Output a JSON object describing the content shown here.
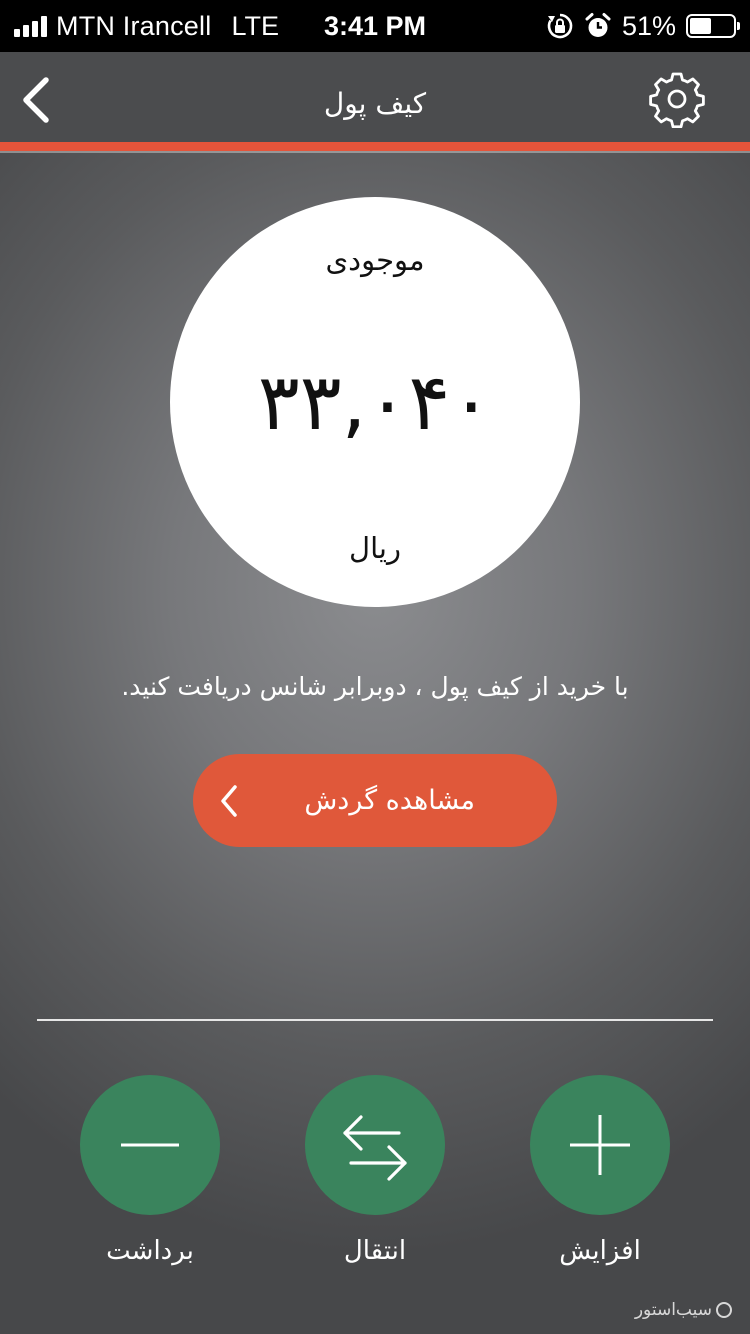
{
  "status_bar": {
    "carrier": "MTN Irancell",
    "network": "LTE",
    "time": "3:41 PM",
    "battery": "51%",
    "battery_level": 0.51
  },
  "header": {
    "title": "کیف پول",
    "back_icon": "chevron-left-icon",
    "settings_icon": "gear-icon"
  },
  "balance": {
    "label": "موجودی",
    "amount": "۳۳,۰۴۰",
    "currency": "ریال"
  },
  "promo": {
    "text": "با خرید از کیف پول ، دوبرابر شانس دریافت کنید."
  },
  "history_button": {
    "label": "مشاهده گردش"
  },
  "actions": [
    {
      "label": "برداشت",
      "icon": "minus-icon"
    },
    {
      "label": "انتقال",
      "icon": "transfer-arrows-icon"
    },
    {
      "label": "افزایش",
      "icon": "plus-icon"
    }
  ],
  "watermark": {
    "text": "سیب‌استور"
  },
  "colors": {
    "accent": "#e5543a",
    "action_green": "#3a845d",
    "nav_background": "#4b4c4e"
  }
}
